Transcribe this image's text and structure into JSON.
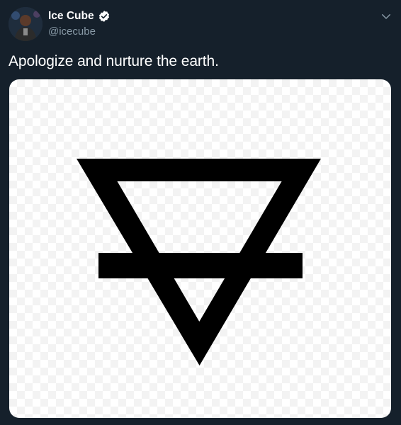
{
  "user": {
    "display_name": "Ice Cube",
    "handle": "@icecube",
    "verified": true
  },
  "tweet": {
    "text": "Apologize and nurture the earth."
  },
  "media": {
    "symbol": "earth-element-symbol",
    "background": "transparency-checkerboard"
  },
  "icons": {
    "verified": "verified-badge-icon",
    "menu": "chevron-down-icon"
  },
  "colors": {
    "background": "#15202b",
    "text_primary": "#ffffff",
    "text_secondary": "#8899a6",
    "symbol": "#000000"
  }
}
